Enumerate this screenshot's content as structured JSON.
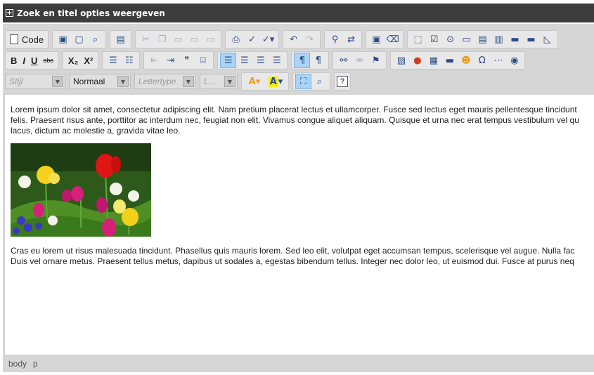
{
  "titlebar": {
    "toggle_glyph": "+",
    "label": "Zoek en titel opties weergeven"
  },
  "toolbar": {
    "code_label": "Code",
    "bold_label": "B",
    "italic_label": "I",
    "underline_label": "U",
    "strike_label": "abc",
    "subscript_label": "X₂",
    "superscript_label": "X²",
    "style_combo": "Stijl",
    "format_combo": "Normaal",
    "font_combo": "Lettertype",
    "size_combo": "L...",
    "help_label": "?"
  },
  "content": {
    "paragraph1": [
      "Lorem ipsum dolor sit amet, consectetur adipiscing elit. Nam pretium placerat lectus et ullamcorper. Fusce sed lectus eget mauris pellentesque tincidunt",
      "felis. Praesent risus ante, porttitor ac interdum nec, feugiat non elit. Vivamus congue aliquet aliquam. Quisque et urna nec erat tempus vestibulum vel qu",
      "lacus, dictum ac molestie a, gravida vitae leo."
    ],
    "paragraph2": [
      "Cras eu lorem ut risus malesuada tincidunt. Phasellus quis mauris lorem. Sed leo elit, volutpat eget accumsan tempus, scelerisque vel augue. Nulla fac",
      "Duis vel ornare metus. Praesent tellus metus, dapibus ut sodales a, egestas bibendum tellus. Integer nec dolor leo, ut euismod dui. Fusce at purus neq"
    ]
  },
  "statusbar": {
    "path": [
      "body",
      "p"
    ]
  },
  "colors": {
    "accent_icon": "#2b4c86",
    "active_button": "#aad4f5",
    "titlebar_bg": "#3c3c3c",
    "editor_bg": "#d6d6d6"
  }
}
